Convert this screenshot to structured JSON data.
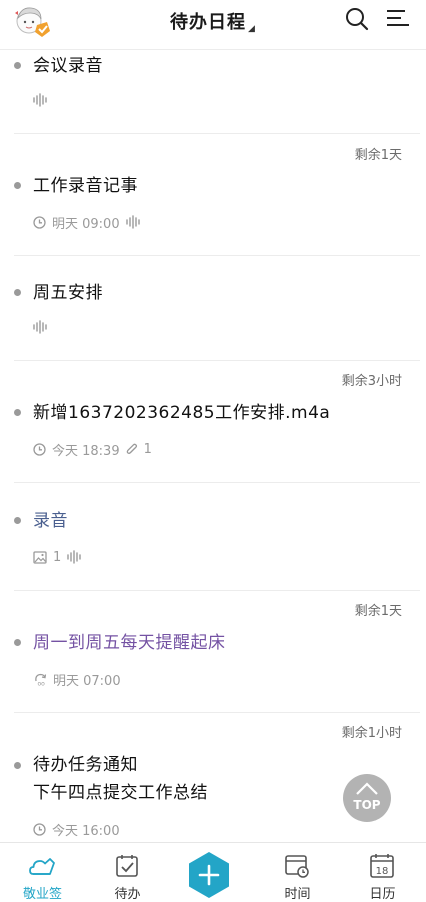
{
  "header": {
    "title": "待办日程",
    "caret": "◢"
  },
  "items": [
    {
      "title": "会议录音",
      "remaining": "",
      "time": "",
      "attach_count": ""
    },
    {
      "title": "工作录音记事",
      "remaining": "剩余1天",
      "time": "明天  09:00",
      "attach_count": ""
    },
    {
      "title": "周五安排",
      "remaining": "",
      "time": "",
      "attach_count": ""
    },
    {
      "title": "新增1637202362485工作安排.m4a",
      "remaining": "剩余3小时",
      "time": "今天  18:39",
      "attach_count": "1"
    },
    {
      "title": "录音",
      "remaining": "",
      "time": "",
      "attach_count": "1"
    },
    {
      "title": "周一到周五每天提醒起床",
      "remaining": "剩余1天",
      "time": "明天  07:00",
      "attach_count": ""
    },
    {
      "title_line1": "待办任务通知",
      "title_line2": "下午四点提交工作总结",
      "remaining": "剩余1小时",
      "time": "今天  16:00"
    }
  ],
  "top_button": {
    "label": "TOP"
  },
  "tabbar": {
    "tabs": [
      {
        "label": "敬业签",
        "icon": "cloud-note-icon",
        "active": true
      },
      {
        "label": "待办",
        "icon": "todo-check-icon",
        "active": false
      },
      {
        "label": "",
        "icon": "add-icon",
        "active": false
      },
      {
        "label": "时间",
        "icon": "time-calendar-icon",
        "active": false
      },
      {
        "label": "日历",
        "icon": "calendar-18-icon",
        "active": false
      }
    ],
    "calendar_day": "18"
  },
  "colors": {
    "accent": "#23a5c7",
    "blue_title": "#4a5f8f",
    "purple_title": "#7452a3",
    "meta": "#9a9a9a"
  }
}
